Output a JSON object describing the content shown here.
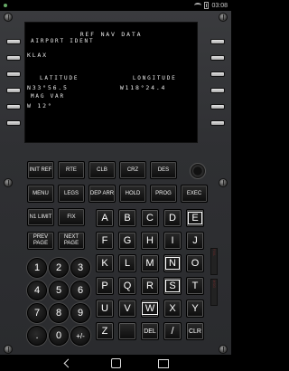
{
  "status": {
    "time": "03:08"
  },
  "cdu": {
    "title": "REF NAV DATA",
    "lines": [
      "AIRPORT IDENT",
      "KLAX",
      "LATITUDE           LONGITUDE",
      "N33°56.5          W118°24.4",
      "MAG VAR",
      "W 12°"
    ]
  },
  "keys": {
    "function": [
      "INIT REF",
      "RTE",
      "CLB",
      "CRZ",
      "DES",
      "MENU",
      "LEGS",
      "DEP ARR",
      "HOLD",
      "PROG",
      "EXEC",
      "N1 LIMIT",
      "FIX",
      "PREV PAGE",
      "NEXT PAGE"
    ],
    "alpha": [
      "A",
      "B",
      "C",
      "D",
      "E",
      "F",
      "G",
      "H",
      "I",
      "J",
      "K",
      "L",
      "M",
      "N",
      "O",
      "P",
      "Q",
      "R",
      "S",
      "T",
      "U",
      "V",
      "W",
      "X",
      "Y",
      "Z",
      "DEL",
      "/",
      "CLR"
    ],
    "numeric": [
      "1",
      "2",
      "3",
      "4",
      "5",
      "6",
      "7",
      "8",
      "9",
      ".",
      "0",
      "+/-"
    ]
  },
  "indicators": {
    "right_labels": [
      "FAIL",
      "MSG"
    ]
  },
  "colors": {
    "screen_text": "#e8e8e8",
    "panel": "#2f3033",
    "key": "#0c0c0c"
  }
}
